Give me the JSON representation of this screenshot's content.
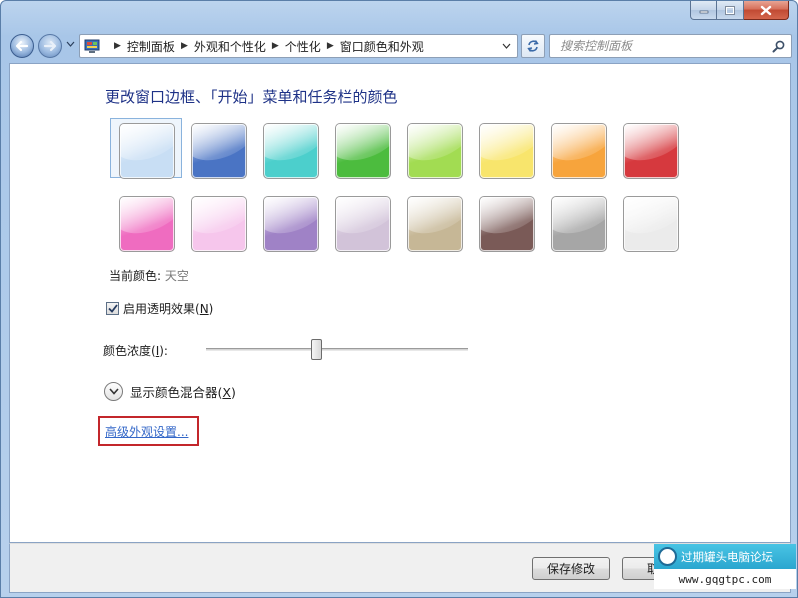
{
  "breadcrumb": [
    "控制面板",
    "外观和个性化",
    "个性化",
    "窗口颜色和外观"
  ],
  "search": {
    "placeholder": "搜索控制面板"
  },
  "heading": "更改窗口边框、「开始」菜单和任务栏的颜色",
  "swatches": [
    {
      "color": "#c8def4",
      "selected": true
    },
    {
      "color": "#4a74c4",
      "selected": false
    },
    {
      "color": "#4ccfcc",
      "selected": false
    },
    {
      "color": "#4cbc3e",
      "selected": false
    },
    {
      "color": "#a2dc52",
      "selected": false
    },
    {
      "color": "#f8e56c",
      "selected": false
    },
    {
      "color": "#f7a43c",
      "selected": false
    },
    {
      "color": "#d6393e",
      "selected": false
    },
    {
      "color": "#ef6cc0",
      "selected": false
    },
    {
      "color": "#f6c6ec",
      "selected": false
    },
    {
      "color": "#9f82c6",
      "selected": false
    },
    {
      "color": "#d2c3d9",
      "selected": false
    },
    {
      "color": "#c6b796",
      "selected": false
    },
    {
      "color": "#7a5a57",
      "selected": false
    },
    {
      "color": "#a6a6a6",
      "selected": false
    },
    {
      "color": "#ebebeb",
      "selected": false
    }
  ],
  "current_color": {
    "label": "当前颜色:",
    "value": "天空"
  },
  "transparency": {
    "label_pre": "启用透明效果(",
    "key": "N",
    "label_post": ")",
    "checked": true
  },
  "intensity": {
    "label_pre": "颜色浓度(",
    "key": "I",
    "label_post": "):",
    "value": 0.42
  },
  "mixer": {
    "label_pre": "显示颜色混合器(",
    "key": "X",
    "label_post": ")"
  },
  "advanced_link": "高级外观设置...",
  "buttons": {
    "save": "保存修改",
    "cancel": "取消"
  },
  "watermark": {
    "title": "过期罐头电脑论坛",
    "url": "www.gqgtpc.com"
  },
  "colors": {
    "heading": "#1e3287",
    "link": "#3367c8",
    "highlight": "#c3262b"
  }
}
